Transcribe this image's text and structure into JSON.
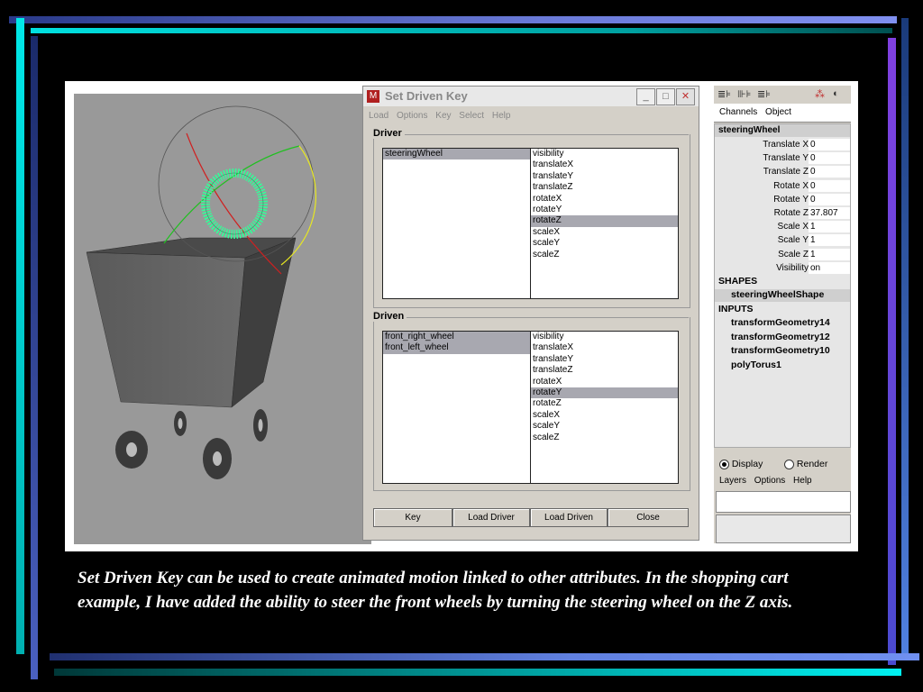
{
  "dialog": {
    "title": "Set Driven Key",
    "menu": [
      "Load",
      "Options",
      "Key",
      "Select",
      "Help"
    ],
    "window_buttons": {
      "minimize": "_",
      "maximize": "□",
      "close": "✕"
    },
    "driver": {
      "label": "Driver",
      "objects": [
        {
          "name": "steeringWheel",
          "selected": true
        }
      ],
      "attributes": [
        {
          "name": "visibility",
          "selected": false
        },
        {
          "name": "translateX",
          "selected": false
        },
        {
          "name": "translateY",
          "selected": false
        },
        {
          "name": "translateZ",
          "selected": false
        },
        {
          "name": "rotateX",
          "selected": false
        },
        {
          "name": "rotateY",
          "selected": false
        },
        {
          "name": "rotateZ",
          "selected": true
        },
        {
          "name": "scaleX",
          "selected": false
        },
        {
          "name": "scaleY",
          "selected": false
        },
        {
          "name": "scaleZ",
          "selected": false
        }
      ]
    },
    "driven": {
      "label": "Driven",
      "objects": [
        {
          "name": "front_right_wheel",
          "selected": true
        },
        {
          "name": "front_left_wheel",
          "selected": true
        }
      ],
      "attributes": [
        {
          "name": "visibility",
          "selected": false
        },
        {
          "name": "translateX",
          "selected": false
        },
        {
          "name": "translateY",
          "selected": false
        },
        {
          "name": "translateZ",
          "selected": false
        },
        {
          "name": "rotateX",
          "selected": false
        },
        {
          "name": "rotateY",
          "selected": true
        },
        {
          "name": "rotateZ",
          "selected": false
        },
        {
          "name": "scaleX",
          "selected": false
        },
        {
          "name": "scaleY",
          "selected": false
        },
        {
          "name": "scaleZ",
          "selected": false
        }
      ]
    },
    "buttons": {
      "key": "Key",
      "load_driver": "Load Driver",
      "load_driven": "Load Driven",
      "close": "Close"
    }
  },
  "channel_box": {
    "tool_icons": {
      "t1": "≣⊧",
      "t2": "⊪⊧",
      "t3": "≣⊧",
      "t4": "⁂",
      "t5": "◐"
    },
    "menu": [
      "Channels",
      "Object"
    ],
    "node": "steeringWheel",
    "channels": [
      {
        "label": "Translate X",
        "value": "0"
      },
      {
        "label": "Translate Y",
        "value": "0"
      },
      {
        "label": "Translate Z",
        "value": "0"
      },
      {
        "label": "Rotate X",
        "value": "0"
      },
      {
        "label": "Rotate Y",
        "value": "0"
      },
      {
        "label": "Rotate Z",
        "value": "37.807"
      },
      {
        "label": "Scale X",
        "value": "1"
      },
      {
        "label": "Scale Y",
        "value": "1"
      },
      {
        "label": "Scale Z",
        "value": "1"
      },
      {
        "label": "Visibility",
        "value": "on"
      }
    ],
    "shapes_label": "SHAPES",
    "shapes": [
      "steeringWheelShape"
    ],
    "inputs_label": "INPUTS",
    "inputs": [
      "transformGeometry14",
      "transformGeometry12",
      "transformGeometry10",
      "polyTorus1"
    ],
    "layer_mode": {
      "display": "Display",
      "render": "Render",
      "selected": "Display"
    },
    "layers_menu": [
      "Layers",
      "Options",
      "Help"
    ]
  },
  "caption": "Set Driven Key can be used to create animated motion linked to other attributes. In the shopping cart example, I have added the ability to steer the front wheels by turning the steering wheel on the Z axis.",
  "colors": {
    "selection": "#a8a8b0",
    "torus": "#33ff99",
    "viewport": "#999999",
    "dialog_bg": "#d4d0c8"
  }
}
